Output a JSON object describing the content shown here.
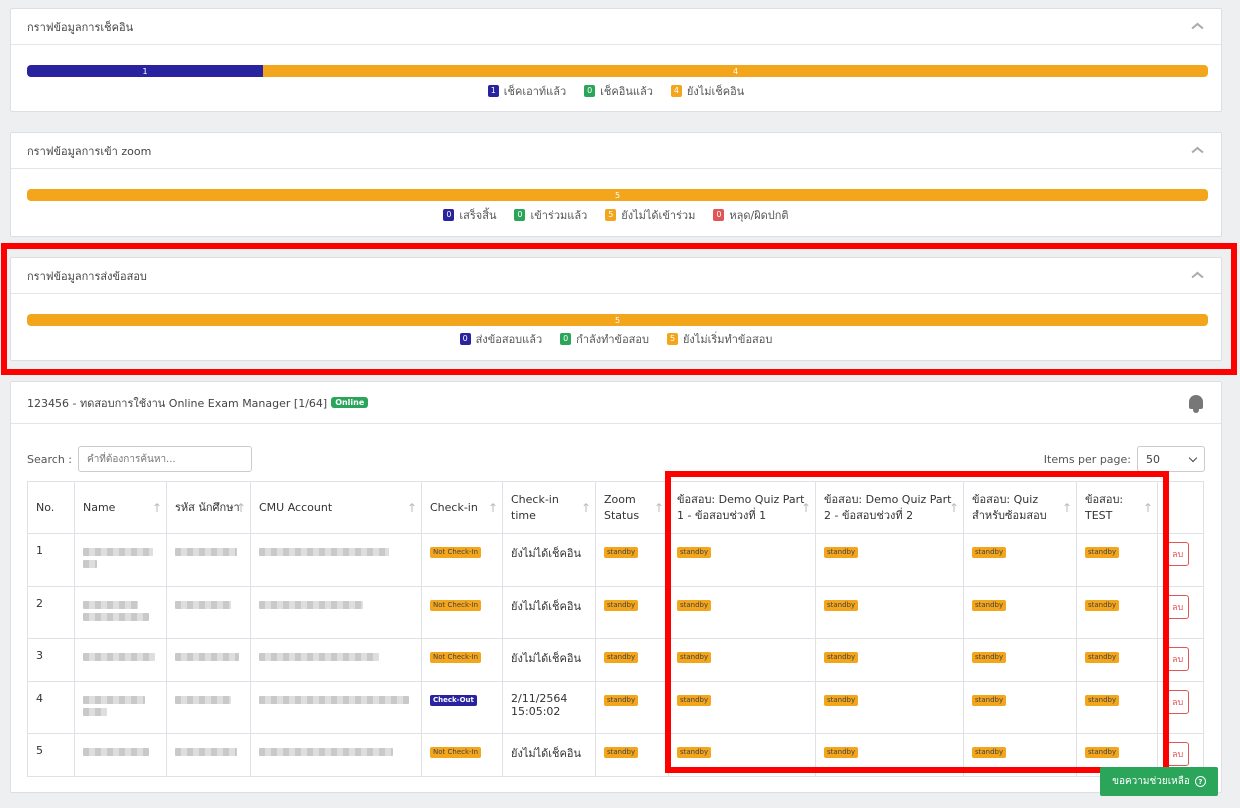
{
  "checkin_card": {
    "title": "กราฟข้อมูลการเช็คอิน",
    "segments": [
      {
        "label": "1",
        "share": 0.2,
        "color": "#2a23a0"
      },
      {
        "label": "4",
        "share": 0.8,
        "color": "#f3a51b"
      }
    ],
    "legend": [
      {
        "count": "1",
        "label": "เช็คเอาท์แล้ว",
        "color": "#2a23a0"
      },
      {
        "count": "0",
        "label": "เช็คอินแล้ว",
        "color": "#2aa55a"
      },
      {
        "count": "4",
        "label": "ยังไม่เช็คอิน",
        "color": "#f3a51b"
      }
    ]
  },
  "zoom_card": {
    "title": "กราฟข้อมูลการเข้า zoom",
    "segments": [
      {
        "label": "5",
        "share": 1.0,
        "color": "#f3a51b"
      }
    ],
    "legend": [
      {
        "count": "0",
        "label": "เสร็จสิ้น",
        "color": "#2a23a0"
      },
      {
        "count": "0",
        "label": "เข้าร่วมแล้ว",
        "color": "#2aa55a"
      },
      {
        "count": "5",
        "label": "ยังไม่ได้เข้าร่วม",
        "color": "#f3a51b"
      },
      {
        "count": "0",
        "label": "หลุด/ผิดปกติ",
        "color": "#e05555"
      }
    ]
  },
  "submit_card": {
    "title": "กราฟข้อมูลการส่งข้อสอบ",
    "segments": [
      {
        "label": "5",
        "share": 1.0,
        "color": "#f3a51b"
      }
    ],
    "legend": [
      {
        "count": "0",
        "label": "ส่งข้อสอบแล้ว",
        "color": "#2a23a0"
      },
      {
        "count": "0",
        "label": "กำลังทำข้อสอบ",
        "color": "#2aa55a"
      },
      {
        "count": "5",
        "label": "ยังไม่เริ่มทำข้อสอบ",
        "color": "#f3a51b"
      }
    ]
  },
  "exam": {
    "title": "123456 - ทดสอบการใช้งาน Online Exam Manager [1/64]",
    "status": "Online",
    "search_label": "Search :",
    "search_placeholder": "คำที่ต้องการค้นหา...",
    "ipp_label": "Items per page:",
    "ipp_value": "50",
    "columns": {
      "no": "No.",
      "name": "Name",
      "sid": "รหัส นักศึกษา",
      "cmu": "CMU Account",
      "checkin": "Check-in",
      "checkin_time": "Check-in time",
      "zoom": "Zoom Status",
      "q1": "ข้อสอบ: Demo Quiz Part 1 - ข้อสอบช่วงที่ 1",
      "q2": "ข้อสอบ: Demo Quiz Part 2 - ข้อสอบช่วงที่ 2",
      "q3": "ข้อสอบ: Quiz สำหรับซ้อมสอบ",
      "q4": "ข้อสอบ: TEST"
    },
    "rows": [
      {
        "no": "1",
        "checkin": "Not Check-In",
        "time": "ยังไม่ได้เช็คอิน",
        "zoom": "standby",
        "q1": "standby",
        "q2": "standby",
        "q3": "standby",
        "q4": "standby",
        "del": "ลบ"
      },
      {
        "no": "2",
        "checkin": "Not Check-In",
        "time": "ยังไม่ได้เช็คอิน",
        "zoom": "standby",
        "q1": "standby",
        "q2": "standby",
        "q3": "standby",
        "q4": "standby",
        "del": "ลบ"
      },
      {
        "no": "3",
        "checkin": "Not Check-In",
        "time": "ยังไม่ได้เช็คอิน",
        "zoom": "standby",
        "q1": "standby",
        "q2": "standby",
        "q3": "standby",
        "q4": "standby",
        "del": "ลบ"
      },
      {
        "no": "4",
        "checkin": "Check-Out",
        "time": "2/11/2564 15:05:02",
        "zoom": "standby",
        "q1": "standby",
        "q2": "standby",
        "q3": "standby",
        "q4": "standby",
        "del": "ลบ"
      },
      {
        "no": "5",
        "checkin": "Not Check-In",
        "time": "ยังไม่ได้เช็คอิน",
        "zoom": "standby",
        "q1": "standby",
        "q2": "standby",
        "q3": "standby",
        "q4": "standby",
        "del": "ลบ"
      }
    ]
  },
  "help_button": "ขอความช่วยเหลือ",
  "icons": {
    "collapse": "chevron-up-icon",
    "bell": "bell-icon",
    "help": "question-circle-icon",
    "sort": "sort-arrow-icon"
  }
}
